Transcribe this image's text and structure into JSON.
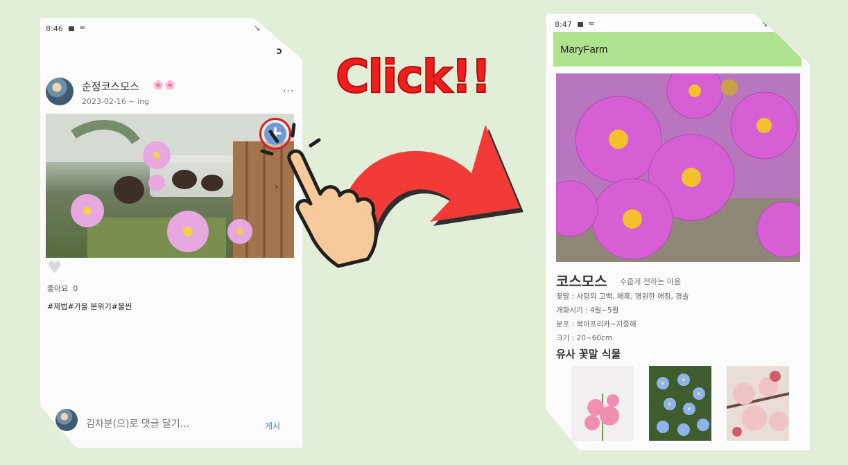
{
  "left_screen": {
    "status_time": "8:46",
    "post": {
      "username": "순정코스모스",
      "flower_emojis": "🌸🌸",
      "date_range": "2023-02-16 ~ ing",
      "more_icon": "more-horizontal-icon",
      "likes_label": "좋아요",
      "likes_count": "0",
      "hashtags": "#제법#가을 분위기#물씬"
    },
    "comment": {
      "placeholder": "김차분(으)로 댓글 달기...",
      "post_label": "게시"
    }
  },
  "callout": {
    "text": "Click!!",
    "color": "#ee1f1f"
  },
  "right_screen": {
    "status_time": "8:47",
    "app_title": "MaryFarm",
    "appbar_color": "#b0e38f",
    "plant": {
      "name": "코스모스",
      "subtitle": "수줍게 전하는 마음",
      "flower_language": "꽃말 : 사랑의 고백, 매혹, 영원한 애정, 경솔",
      "bloom_period": "개화시기 : 4월~5월",
      "distribution": "분포 : 북아프리카~지중해",
      "size": "크기 : 20~60cm"
    },
    "similar_section_title": "유사 꽃말 식물"
  }
}
